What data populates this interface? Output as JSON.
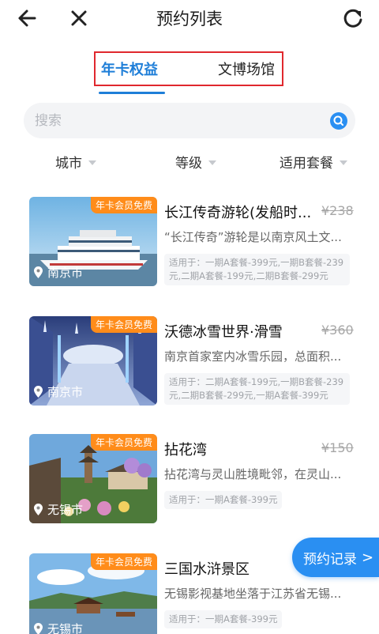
{
  "header": {
    "title": "预约列表",
    "icons": [
      "back-arrow",
      "close-x",
      "refresh"
    ]
  },
  "tabs": [
    {
      "label": "年卡权益",
      "active": true
    },
    {
      "label": "文博场馆",
      "active": false
    }
  ],
  "search": {
    "placeholder": "搜索",
    "value": ""
  },
  "filters": [
    {
      "label": "城市"
    },
    {
      "label": "等级"
    },
    {
      "label": "适用套餐"
    }
  ],
  "badge_text": "年卡会员免费",
  "items": [
    {
      "name": "长江传奇游轮(发船时...",
      "price": "¥238",
      "desc": "“长江传奇”游轮是以南京风土文...",
      "apply": "适用于：一期A套餐-399元,一期B套餐-239元,二期A套餐-199元,二期B套餐-299元",
      "city": "南京市"
    },
    {
      "name": "沃德冰雪世界·滑雪",
      "price": "¥360",
      "desc": "南京首家室内冰雪乐园，总面积...",
      "apply": "适用于：二期A套餐-199元,一期B套餐-239元,二期B套餐-299元,一期A套餐-399元",
      "city": "南京市"
    },
    {
      "name": "拈花湾",
      "price": "¥150",
      "desc": "拈花湾与灵山胜境毗邻，在灵山...",
      "apply": "适用于：一期A套餐-399元",
      "city": "无锡市"
    },
    {
      "name": "三国水浒景区",
      "price": "",
      "desc": "无锡影视基地坐落于江苏省无锡...",
      "apply": "适用于：一期A套餐-399元",
      "city": "无锡市"
    }
  ],
  "floating_button": {
    "label": "预约记录",
    "chevron": ">"
  },
  "colors": {
    "accent": "#1e7ed8",
    "badge": "#ff8c1a",
    "highlight": "#e0282e",
    "button": "#2a8ff2"
  }
}
